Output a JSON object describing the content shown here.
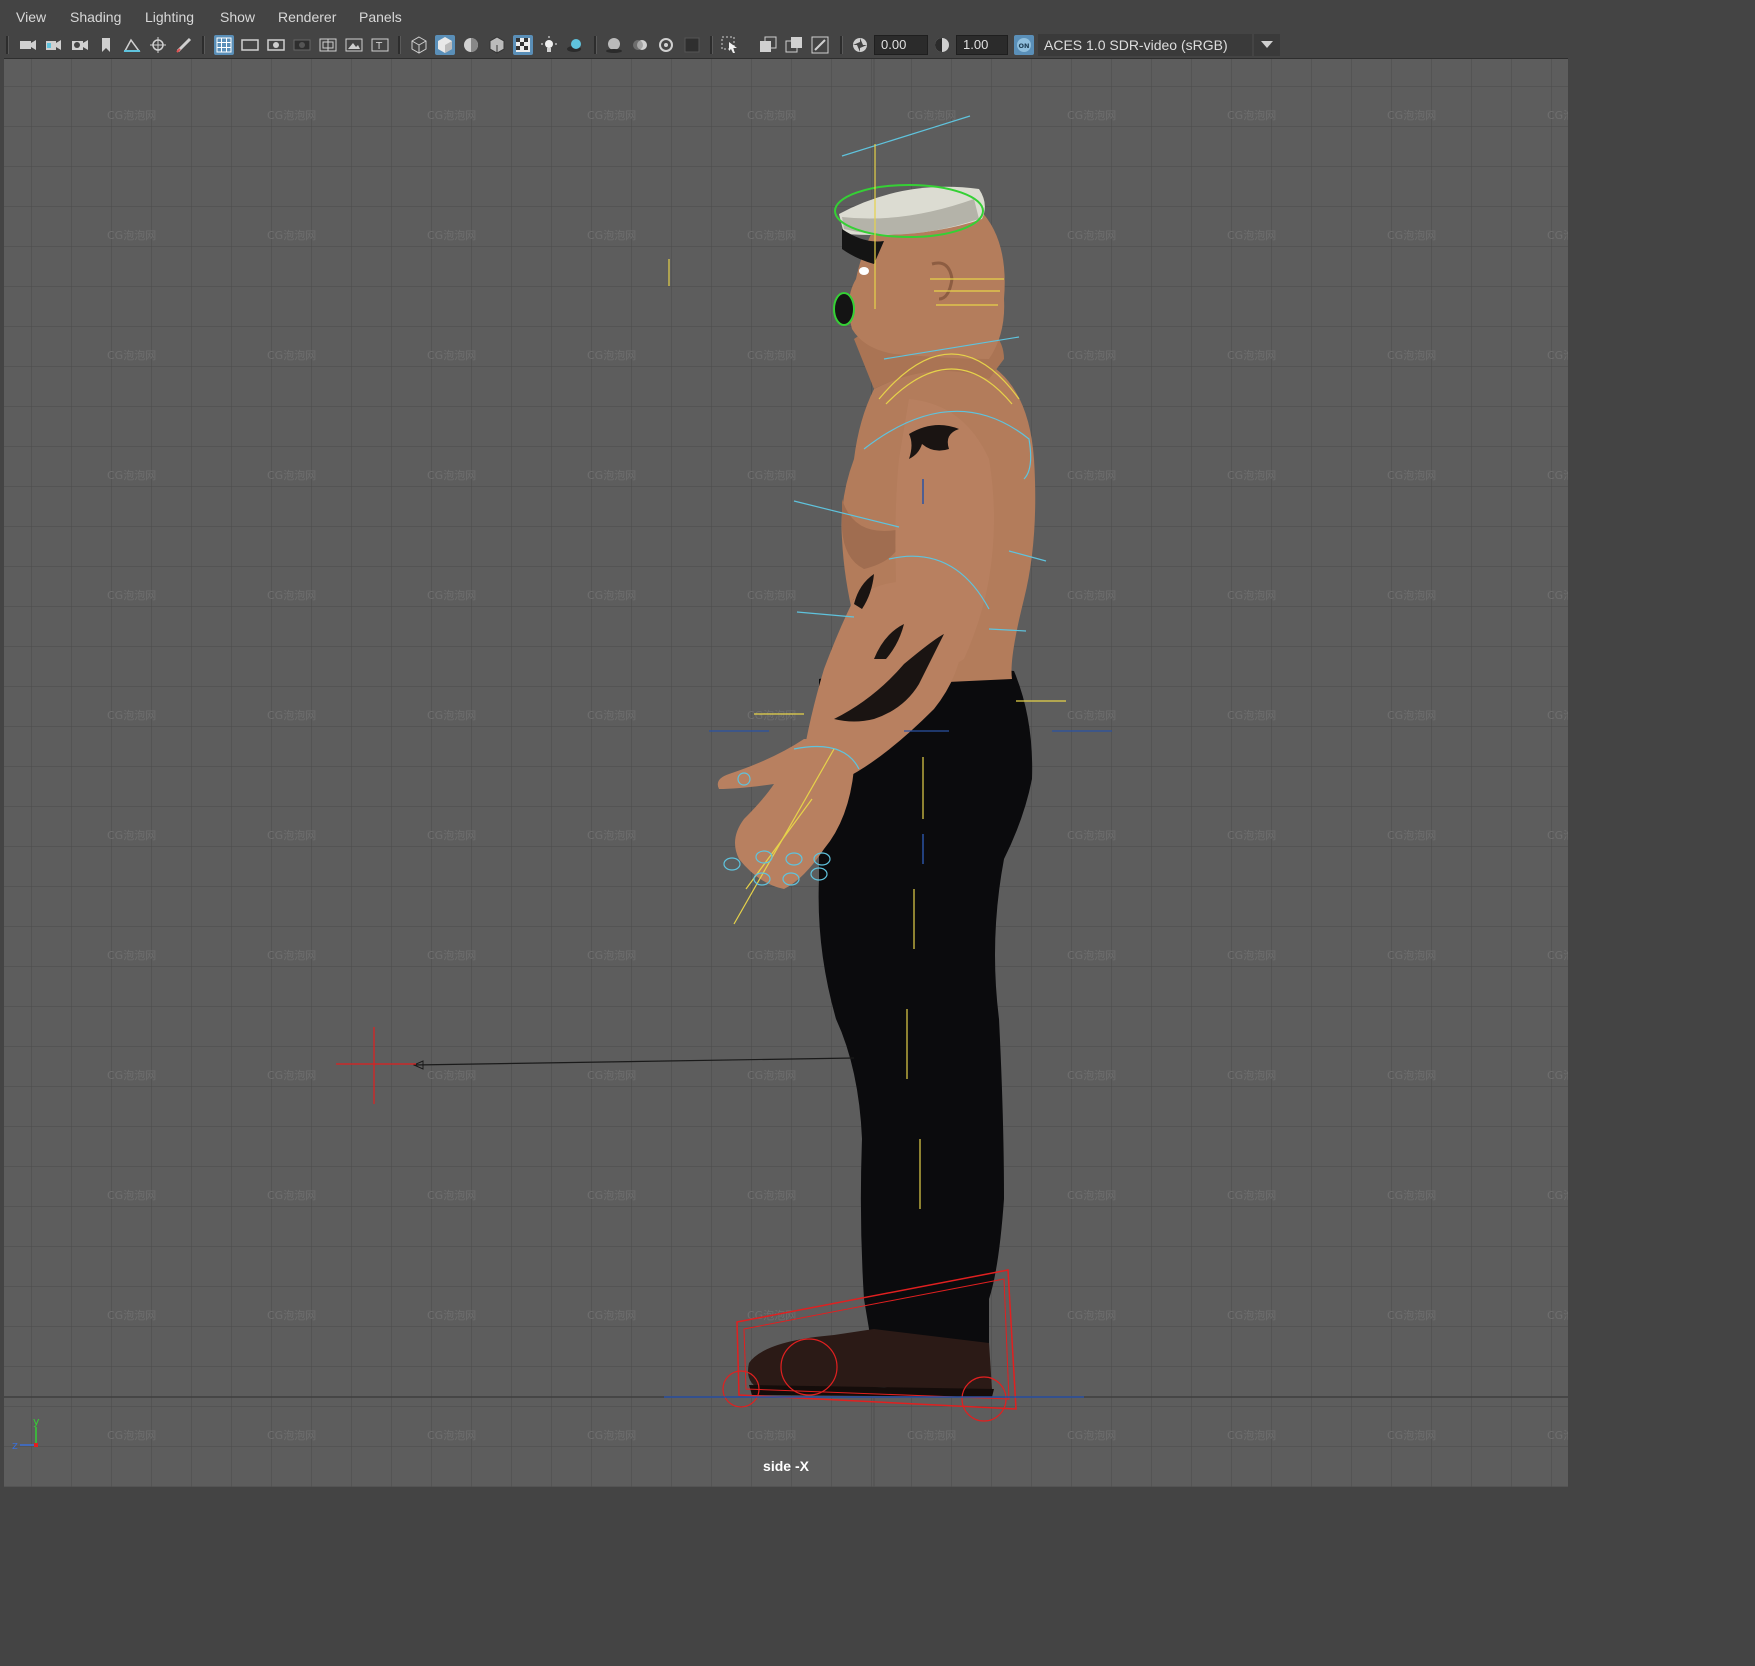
{
  "menu": [
    "View",
    "Shading",
    "Lighting",
    "Show",
    "Renderer",
    "Panels"
  ],
  "toolbar": {
    "exposure_value": "0.00",
    "gamma_value": "1.00",
    "color_management_toggle": "ON",
    "color_space": "ACES 1.0 SDR-video (sRGB)"
  },
  "viewport": {
    "camera_label": "side -X",
    "watermark": "CG泡泡网",
    "axis_labels": {
      "y": "y",
      "z": "z"
    }
  },
  "icons": [
    "camera-icon",
    "camera-attributes-icon",
    "camera-settings-icon",
    "bookmark-icon",
    "image-plane-icon",
    "2d-pan-zoom-icon",
    "grease-pencil-icon",
    "grid-icon",
    "film-gate-icon",
    "resolution-gate-icon",
    "gate-mask-icon",
    "field-chart-icon",
    "safe-action-icon",
    "safe-title-icon",
    "wireframe-icon",
    "smooth-shade-icon",
    "default-material-icon",
    "wireframe-on-shaded-icon",
    "textured-icon",
    "lights-icon",
    "shadows-icon",
    "screen-space-ao-icon",
    "motion-blur-icon",
    "anti-aliasing-icon",
    "depth-of-field-icon",
    "isolate-select-icon",
    "xray-icon",
    "xray-joints-icon",
    "xray-components-icon",
    "exposure-icon",
    "gamma-icon",
    "dropdown-icon"
  ],
  "colors": {
    "background": "#444444",
    "viewport": "#5d5d5d",
    "grid": "#4a4a4a",
    "active_icon": "#5a8fb8",
    "control_cyan": "#5fc3dd",
    "control_yellow": "#e6d24a",
    "control_red": "#e02020",
    "control_green": "#35d035"
  }
}
